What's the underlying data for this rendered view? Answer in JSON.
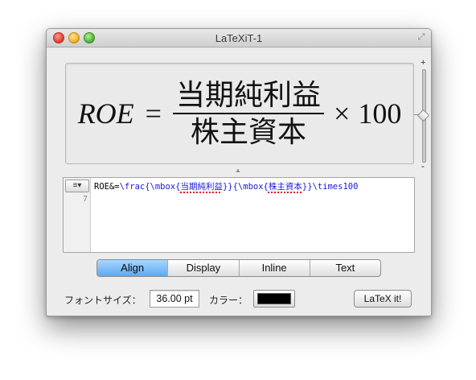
{
  "window": {
    "title": "LaTeXiT-1",
    "fullscreen_icon": "fullscreen-arrows-icon"
  },
  "preview": {
    "lhs": "ROE",
    "equals": "=",
    "numerator": "当期純利益",
    "denominator": "株主資本",
    "times": "×",
    "factor": "100",
    "zoom_plus": "+",
    "zoom_minus": "-"
  },
  "editor": {
    "menu_label": "≡▾",
    "line_number": "7",
    "code_prefix": "ROE&=",
    "code_frac": "\\frac{\\mbox{",
    "code_num": "当期純利益",
    "code_mid": "}}{\\mbox{",
    "code_den": "株主資本",
    "code_end": "}}\\times100"
  },
  "modes": [
    "Align",
    "Display",
    "Inline",
    "Text"
  ],
  "selected_mode": "Align",
  "font": {
    "label": "フォントサイズ：",
    "value": "36.00 pt"
  },
  "color": {
    "label": "カラー：",
    "value": "#000000"
  },
  "latex_button": "LaTeX it!"
}
